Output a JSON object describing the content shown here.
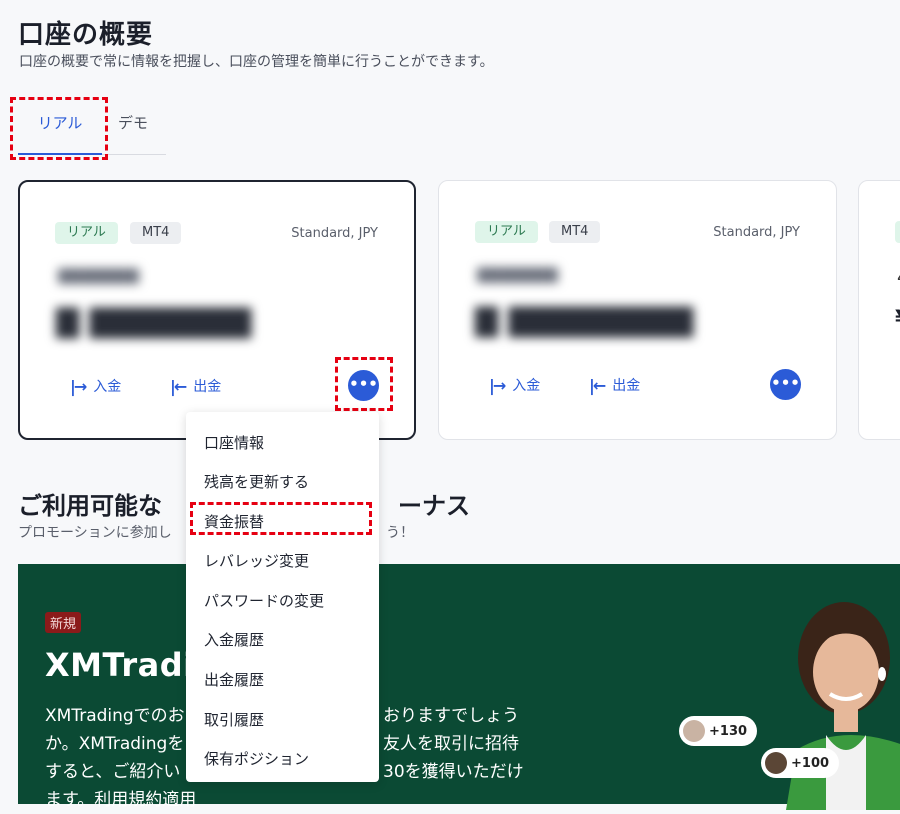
{
  "header": {
    "title": "口座の概要",
    "subtitle": "口座の概要で常に情報を把握し、口座の管理を簡単に行うことができます。"
  },
  "tabs": [
    {
      "label": "リアル",
      "active": true
    },
    {
      "label": "デモ",
      "active": false
    }
  ],
  "accounts": [
    {
      "badge_type": "リアル",
      "platform": "MT4",
      "account_type": "Standard, JPY",
      "deposit_label": "入金",
      "withdraw_label": "出金",
      "more_label": "•••"
    },
    {
      "badge_type": "リアル",
      "platform": "MT4",
      "account_type": "Standard, JPY",
      "deposit_label": "入金",
      "withdraw_label": "出金",
      "more_label": "•••"
    }
  ],
  "partial_card": {
    "digit": "4",
    "currency": "¥"
  },
  "account_menu": {
    "items": [
      "口座情報",
      "残高を更新する",
      "資金振替",
      "レバレッジ変更",
      "パスワードの変更",
      "入金履歴",
      "出金履歴",
      "取引履歴",
      "保有ポジション"
    ]
  },
  "bonus_section": {
    "title_left": "ご利用可能な",
    "title_right": "ーナス",
    "subtitle_left": "プロモーションに参加し",
    "subtitle_right": "う！"
  },
  "promo_banner": {
    "new_badge": "新規",
    "title": "XMTradin",
    "text_left_1": "XMTradingでのお",
    "text_right_1": "おりますでしょう",
    "text_left_2": "か。XMTradingを",
    "text_right_2": "友人を取引に招待",
    "text_left_3": "すると、ご紹介い",
    "text_right_3": "30を獲得いただけ",
    "text_left_4": "ます。利用規約適用",
    "pill_1": "+130",
    "pill_2": "+100"
  },
  "colors": {
    "accent": "#2b5bd7",
    "highlight": "#e60012",
    "banner_bg": "#0b4a34",
    "badge_real_bg": "#dff5ea"
  }
}
